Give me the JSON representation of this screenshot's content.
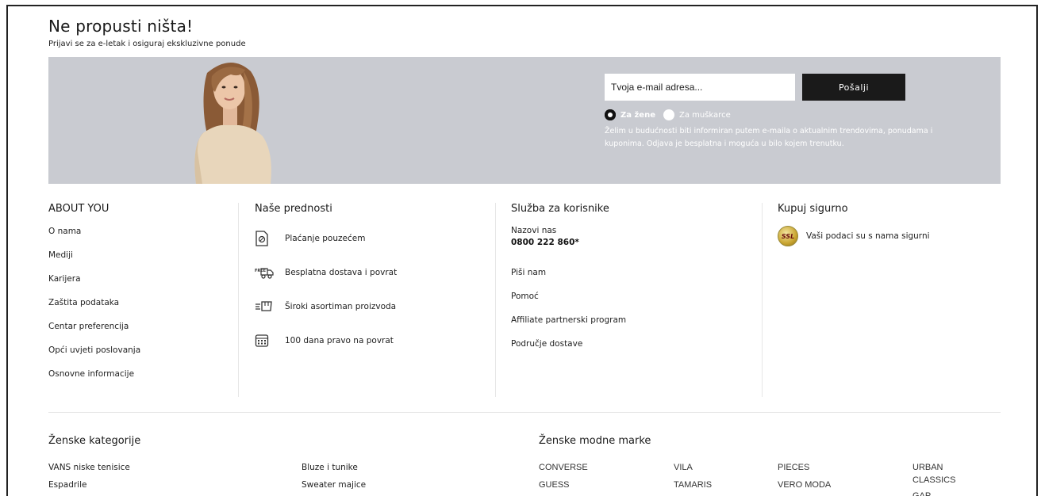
{
  "hero": {
    "title": "Ne propusti ništa!",
    "subtitle": "Prijavi se za e-letak i osiguraj ekskluzivne ponude"
  },
  "newsletter": {
    "email_placeholder": "Tvoja e-mail adresa...",
    "submit_label": "Pošalji",
    "option_women": "Za žene",
    "option_men": "Za muškarce",
    "selected": "Za žene",
    "consent_text": "Želim u budućnosti biti informiran putem e-maila o aktualnim trendovima, ponudama i kuponima. Odjava je besplatna i moguća u bilo kojem trenutku."
  },
  "about": {
    "title": "ABOUT YOU",
    "links": [
      "O nama",
      "Mediji",
      "Karijera",
      "Zaštita podataka",
      "Centar preferencija",
      "Opći uvjeti poslovanja",
      "Osnovne informacije"
    ]
  },
  "advantages": {
    "title": "Naše prednosti",
    "items": [
      {
        "icon": "cash-on-delivery-icon",
        "label": "Plaćanje pouzećem"
      },
      {
        "icon": "free-delivery-truck-icon",
        "label": "Besplatna dostava i povrat"
      },
      {
        "icon": "fast-delivery-box-icon",
        "label": "Široki asortiman proizvoda"
      },
      {
        "icon": "calendar-icon",
        "label": "100 dana pravo na povrat"
      }
    ]
  },
  "service": {
    "title": "Služba za korisnike",
    "call_label": "Nazovi nas",
    "phone": "0800 222 860*",
    "links": [
      "Piši nam",
      "Pomoć",
      "Affiliate partnerski program",
      "Područje dostave"
    ]
  },
  "secure": {
    "title": "Kupuj sigurno",
    "badge_text": "SSL",
    "label": "Vaši podaci su s nama sigurni"
  },
  "women_categories": {
    "title": "Ženske kategorije",
    "col1": [
      "VANS niske tenisice",
      "Espadrile"
    ],
    "col2": [
      "Bluze i tunike",
      "Sweater majice"
    ]
  },
  "women_brands": {
    "title": "Ženske modne marke",
    "col1": [
      "CONVERSE",
      "GUESS"
    ],
    "col2": [
      "VILA",
      "TAMARIS"
    ],
    "col3": [
      "PIECES",
      "VERO MODA"
    ],
    "col4": [
      "URBAN CLASSICS",
      "GAP"
    ]
  },
  "colors": {
    "banner": "#c9cbd1",
    "button": "#1a1a1a"
  }
}
